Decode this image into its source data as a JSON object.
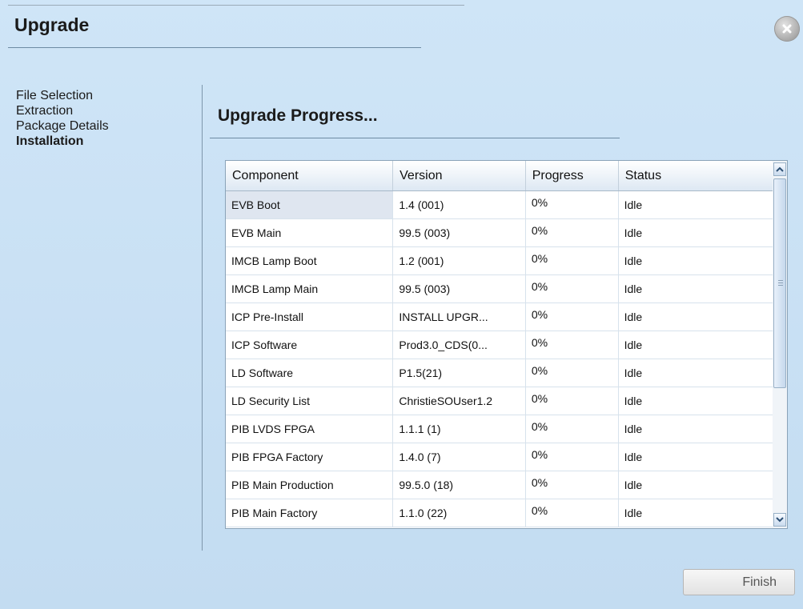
{
  "dialog": {
    "title": "Upgrade"
  },
  "steps": [
    {
      "label": "File Selection",
      "active": false
    },
    {
      "label": "Extraction",
      "active": false
    },
    {
      "label": "Package Details",
      "active": false
    },
    {
      "label": "Installation",
      "active": true
    }
  ],
  "section_title": "Upgrade Progress...",
  "table": {
    "columns": [
      "Component",
      "Version",
      "Progress",
      "Status"
    ],
    "rows": [
      {
        "component": "EVB Boot",
        "version": "1.4 (001)",
        "progress": "0%",
        "status": "Idle"
      },
      {
        "component": "EVB Main",
        "version": "99.5 (003)",
        "progress": "0%",
        "status": "Idle"
      },
      {
        "component": "IMCB Lamp Boot",
        "version": "1.2 (001)",
        "progress": "0%",
        "status": "Idle"
      },
      {
        "component": "IMCB Lamp Main",
        "version": "99.5 (003)",
        "progress": "0%",
        "status": "Idle"
      },
      {
        "component": "ICP Pre-Install",
        "version": "INSTALL UPGR...",
        "progress": "0%",
        "status": "Idle"
      },
      {
        "component": "ICP Software",
        "version": "Prod3.0_CDS(0...",
        "progress": "0%",
        "status": "Idle"
      },
      {
        "component": "LD Software",
        "version": "P1.5(21)",
        "progress": "0%",
        "status": "Idle"
      },
      {
        "component": "LD Security List",
        "version": "ChristieSOUser1.2",
        "progress": "0%",
        "status": "Idle"
      },
      {
        "component": "PIB LVDS FPGA",
        "version": "1.1.1 (1)",
        "progress": "0%",
        "status": "Idle"
      },
      {
        "component": "PIB FPGA Factory",
        "version": "1.4.0 (7)",
        "progress": "0%",
        "status": "Idle"
      },
      {
        "component": "PIB Main Production",
        "version": "99.5.0 (18)",
        "progress": "0%",
        "status": "Idle"
      },
      {
        "component": "PIB Main Factory",
        "version": "1.1.0 (22)",
        "progress": "0%",
        "status": "Idle"
      }
    ]
  },
  "buttons": {
    "finish": "Finish"
  },
  "icons": {
    "close": "close-icon",
    "scroll_up": "chevron-up-icon",
    "scroll_down": "chevron-down-icon"
  }
}
